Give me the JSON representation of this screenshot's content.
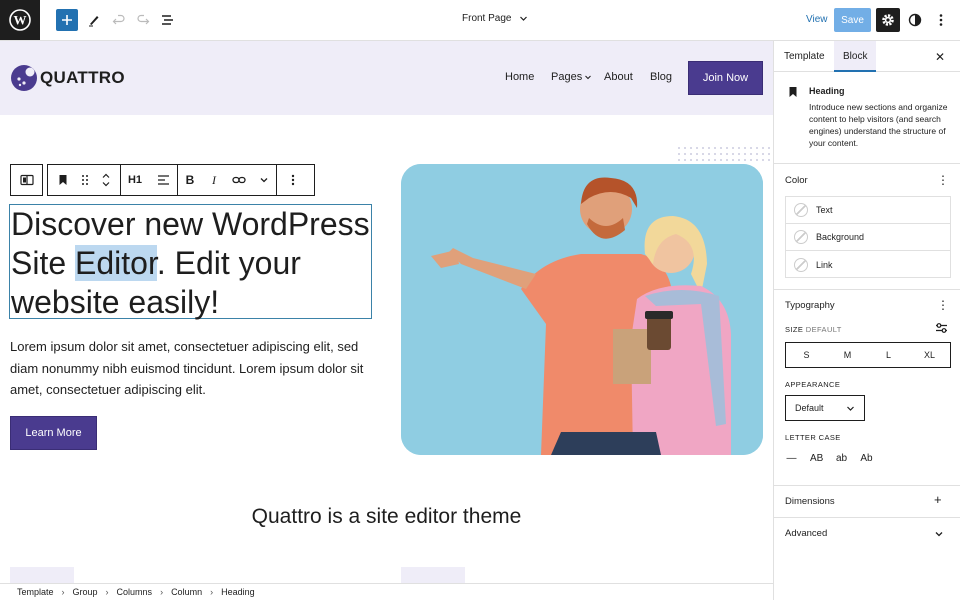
{
  "topbar": {
    "doc_title": "Front Page",
    "view_label": "View",
    "save_label": "Save"
  },
  "site": {
    "logo_text": "QUATTRO",
    "nav": [
      "Home",
      "Pages",
      "About",
      "Blog"
    ],
    "join_label": "Join Now"
  },
  "block_toolbar": {
    "heading_level": "H1",
    "bold": "B",
    "italic": "I"
  },
  "content": {
    "heading_before": "Discover new WordPress Site ",
    "heading_selected": "Editor",
    "heading_after": ". Edit your website easily!",
    "paragraph": "Lorem ipsum dolor sit amet, consectetuer adipiscing elit, sed diam nonummy nibh euismod tincidunt. Lorem ipsum dolor sit amet, consectetuer adipiscing elit.",
    "button_label": "Learn More",
    "subheading": "Quattro is a site editor theme"
  },
  "breadcrumb": [
    "Template",
    "Group",
    "Columns",
    "Column",
    "Heading"
  ],
  "sidebar": {
    "tabs": [
      "Template",
      "Block"
    ],
    "active_tab": "Block",
    "block": {
      "name": "Heading",
      "description": "Introduce new sections and organize content to help visitors (and search engines) understand the structure of your content."
    },
    "color": {
      "title": "Color",
      "items": [
        "Text",
        "Background",
        "Link"
      ]
    },
    "typography": {
      "title": "Typography",
      "size_label": "SIZE",
      "size_value": "DEFAULT",
      "sizes": [
        "S",
        "M",
        "L",
        "XL"
      ],
      "appearance_label": "APPEARANCE",
      "appearance_value": "Default",
      "letter_case_label": "LETTER CASE",
      "letter_cases": [
        "—",
        "AB",
        "ab",
        "Ab"
      ]
    },
    "dimensions_title": "Dimensions",
    "advanced_title": "Advanced"
  },
  "colors": {
    "accent": "#4a3b8f",
    "wp_blue": "#2271b1",
    "header_bg": "#efedf8"
  }
}
